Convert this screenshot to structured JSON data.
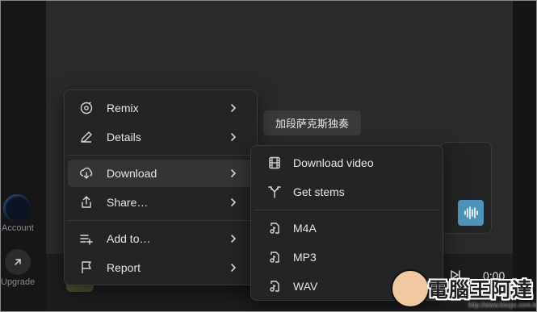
{
  "sidebar": {
    "account_label": "Account",
    "upgrade_label": "Upgrade"
  },
  "tooltip": {
    "text": "加段萨克斯独奏"
  },
  "player": {
    "time": "0:00"
  },
  "context_menu": {
    "items": [
      {
        "label": "Remix",
        "icon": "remix-icon"
      },
      {
        "label": "Details",
        "icon": "pencil-icon"
      },
      {
        "label": "Download",
        "icon": "cloud-download-icon"
      },
      {
        "label": "Share…",
        "icon": "share-icon"
      },
      {
        "label": "Add to…",
        "icon": "add-to-list-icon"
      },
      {
        "label": "Report",
        "icon": "flag-icon"
      }
    ]
  },
  "download_submenu": {
    "items": [
      {
        "label": "Download video",
        "icon": "film-icon"
      },
      {
        "label": "Get stems",
        "icon": "split-icon"
      },
      {
        "label": "M4A",
        "icon": "audio-file-icon"
      },
      {
        "label": "MP3",
        "icon": "audio-file-icon"
      },
      {
        "label": "WAV",
        "icon": "audio-file-icon"
      }
    ]
  },
  "watermark": {
    "text": "電腦王阿達",
    "url": "http://www.kocpc.com.tw"
  },
  "colors": {
    "accent_wave_button": "#4f93b8",
    "menu_bg": "#242426",
    "active_row": "#343437"
  }
}
